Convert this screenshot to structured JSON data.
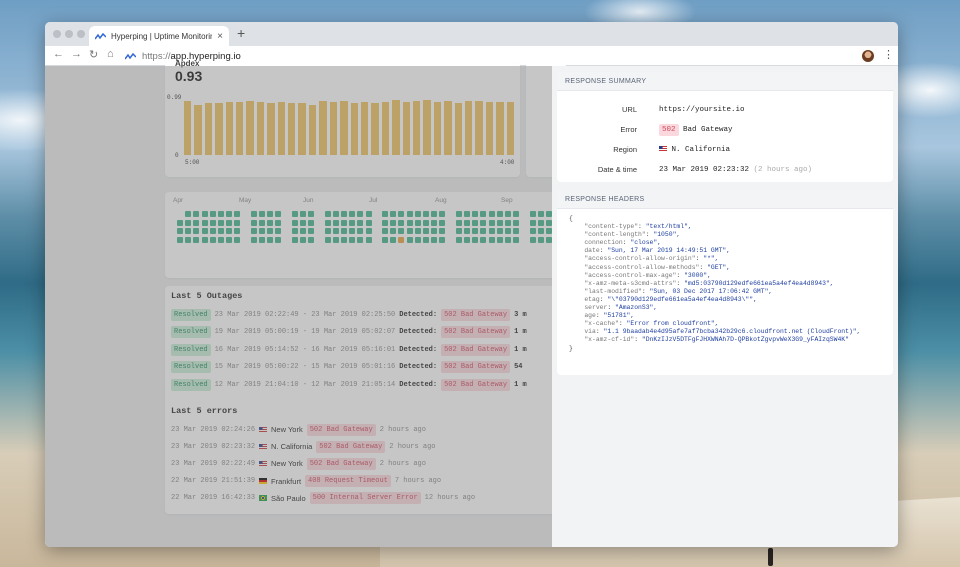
{
  "browser": {
    "tab_title": "Hyperping | Uptime Monitoring",
    "url_scheme": "https://",
    "url_host": "app.hyperping.io",
    "icons": [
      "back-icon",
      "forward-icon",
      "reload-icon",
      "home-icon",
      "hyperping-logo-icon",
      "close-icon",
      "plus-icon",
      "avatar-icon",
      "menu-icon"
    ]
  },
  "apdex": {
    "label": "Apdex",
    "value": "0.93",
    "y_top": "0.99",
    "y_bottom": "0",
    "x_start": "5:00",
    "x_end": "4:00",
    "bar_levels": [
      0.9,
      0.84,
      0.87,
      0.86,
      0.88,
      0.88,
      0.9,
      0.88,
      0.87,
      0.89,
      0.87,
      0.86,
      0.84,
      0.9,
      0.89,
      0.9,
      0.86,
      0.89,
      0.87,
      0.88,
      0.92,
      0.89,
      0.9,
      0.91,
      0.88,
      0.9,
      0.87,
      0.9,
      0.9,
      0.88,
      0.89,
      0.88
    ]
  },
  "calendar": {
    "months": [
      "Apr",
      "May",
      "Jun",
      "Jul",
      "Aug",
      "Sep"
    ],
    "colors": {
      "up": "#3fb38d",
      "incident": "#e8a33c"
    }
  },
  "outages": {
    "title": "Last 5 Outages",
    "rows": [
      {
        "status": "Resolved",
        "range": "23 Mar 2019 02:22:49 - 23 Mar 2019 02:25:50",
        "detected": "Detected:",
        "error": "502 Bad Gateway",
        "duration": "3 m"
      },
      {
        "status": "Resolved",
        "range": "19 Mar 2019 05:00:19 - 19 Mar 2019 05:02:07",
        "detected": "Detected:",
        "error": "502 Bad Gateway",
        "duration": "1 m"
      },
      {
        "status": "Resolved",
        "range": "16 Mar 2019 05:14:52 - 16 Mar 2019 05:16:01",
        "detected": "Detected:",
        "error": "502 Bad Gateway",
        "duration": "1 m"
      },
      {
        "status": "Resolved",
        "range": "15 Mar 2019 05:00:22 - 15 Mar 2019 05:01:16",
        "detected": "Detected:",
        "error": "502 Bad Gateway",
        "duration": "54"
      },
      {
        "status": "Resolved",
        "range": "12 Mar 2019 21:04:10 - 12 Mar 2019 21:05:14",
        "detected": "Detected:",
        "error": "502 Bad Gateway",
        "duration": "1 m"
      }
    ]
  },
  "errors": {
    "title": "Last 5 errors",
    "rows": [
      {
        "time": "23 Mar 2019 02:24:26",
        "flag": "us",
        "city": "New York",
        "error": "502 Bad Gateway",
        "ago": "2 hours ago"
      },
      {
        "time": "23 Mar 2019 02:23:32",
        "flag": "us",
        "city": "N. California",
        "error": "502 Bad Gateway",
        "ago": "2 hours ago"
      },
      {
        "time": "23 Mar 2019 02:22:49",
        "flag": "us",
        "city": "New York",
        "error": "502 Bad Gateway",
        "ago": "2 hours ago"
      },
      {
        "time": "22 Mar 2019 21:51:39",
        "flag": "de",
        "city": "Frankfurt",
        "error": "408 Request Timeout",
        "ago": "7 hours ago"
      },
      {
        "time": "22 Mar 2019 16:42:33",
        "flag": "br",
        "city": "São Paulo",
        "error": "500 Internal Server Error",
        "ago": "12 hours ago"
      }
    ]
  },
  "response_summary": {
    "title": "RESPONSE SUMMARY",
    "url_label": "URL",
    "url_value": "https://yoursite.io",
    "error_label": "Error",
    "error_code": "502",
    "error_text": "Bad Gateway",
    "region_label": "Region",
    "region_value": "N. California",
    "datetime_label": "Date & time",
    "datetime_value": "23 Mar 2019 02:23:32",
    "datetime_ago": "(2 hours ago)"
  },
  "response_headers": {
    "title": "RESPONSE HEADERS",
    "open": "{",
    "close": "}",
    "lines": [
      {
        "key": "\"content-type\"",
        "value": "\"text/html\","
      },
      {
        "key": "\"content-length\"",
        "value": "\"1050\","
      },
      {
        "key": "connection",
        "value": "\"close\","
      },
      {
        "key": "date",
        "value": "\"Sun, 17 Mar 2019 14:49:51 GMT\","
      },
      {
        "key": "\"access-control-allow-origin\"",
        "value": "\"*\","
      },
      {
        "key": "\"access-control-allow-methods\"",
        "value": "\"GET\","
      },
      {
        "key": "\"access-control-max-age\"",
        "value": "\"3000\","
      },
      {
        "key": "\"x-amz-meta-s3cmd-attrs\"",
        "value": "\"md5:03790d129edfe661ea5a4ef4ea4d8943\","
      },
      {
        "key": "\"last-modified\"",
        "value": "\"Sun, 03 Dec 2017 17:06:42 GMT\","
      },
      {
        "key": "etag",
        "value": "\"\\\"03790d129edfe661ea5a4ef4ea4d8943\\\"\","
      },
      {
        "key": "server",
        "value": "\"AmazonS3\","
      },
      {
        "key": "age",
        "value": "\"51781\","
      },
      {
        "key": "\"x-cache\"",
        "value": "\"Error from cloudfront\","
      },
      {
        "key": "via",
        "value": "\"1.1 9baadab4e4d95afe7af7bcba342b29c6.cloudfront.net (CloudFront)\","
      },
      {
        "key": "\"x-amz-cf-id\"",
        "value": "\"DnKzIJzV5DTFgFJHXWNAh7D-QPBkotZgvpvWeX3G9_yFAIzqSW4K\""
      }
    ]
  }
}
